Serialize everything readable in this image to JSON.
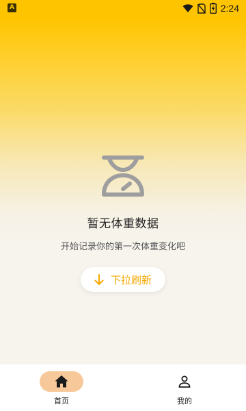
{
  "status_bar": {
    "left_icon": "A",
    "time": "2:24",
    "icons": [
      "wifi-icon",
      "no-sim-icon",
      "battery-charging-icon"
    ]
  },
  "empty_state": {
    "icon": "weight-scale-icon",
    "title": "暂无体重数据",
    "subtitle": "开始记录你的第一次体重变化吧",
    "refresh_button": {
      "icon": "arrow-down-icon",
      "label": "下拉刷新"
    }
  },
  "bottom_nav": {
    "items": [
      {
        "label": "首页",
        "icon": "home-icon",
        "active": true
      },
      {
        "label": "我的",
        "icon": "person-icon",
        "active": false
      }
    ]
  },
  "colors": {
    "accent": "#FFC400",
    "button_text": "#F5A800",
    "nav_active_pill": "#F7C99A",
    "background_bottom": "#F7F4EE"
  }
}
